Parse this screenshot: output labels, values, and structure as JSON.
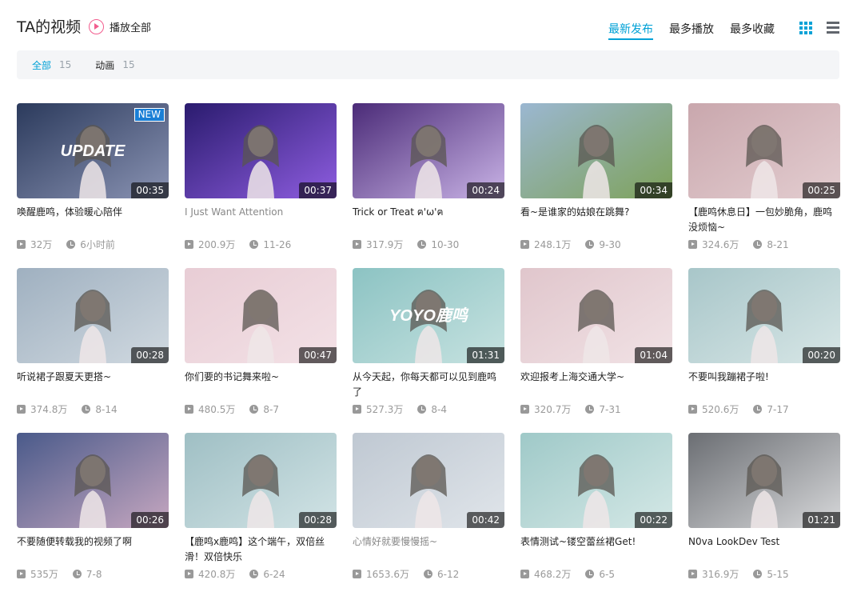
{
  "header": {
    "title": "TA的视频",
    "play_all": "播放全部",
    "sorts": [
      {
        "label": "最新发布",
        "active": true
      },
      {
        "label": "最多播放",
        "active": false
      },
      {
        "label": "最多收藏",
        "active": false
      }
    ]
  },
  "filters": [
    {
      "label": "全部",
      "count": "15",
      "active": true
    },
    {
      "label": "动画",
      "count": "15",
      "active": false
    }
  ],
  "colors": {
    "accent": "#00a1d6",
    "pink": "#f25d8e"
  },
  "videos": [
    {
      "title": "唤醒鹿鸣，体验暖心陪伴",
      "duration": "00:35",
      "views": "32万",
      "date": "6小时前",
      "badge": "NEW",
      "thumb_text": "UPDATE",
      "muted": false,
      "bg1": "#2b3a5c",
      "bg2": "#8a93b3"
    },
    {
      "title": "I Just Want Attention",
      "duration": "00:37",
      "views": "200.9万",
      "date": "11-26",
      "muted": true,
      "bg1": "#2a1b6e",
      "bg2": "#8e5de0"
    },
    {
      "title": "Trick or Treat ฅ'ω'ฅ",
      "duration": "00:24",
      "views": "317.9万",
      "date": "10-30",
      "muted": false,
      "bg1": "#4b2b78",
      "bg2": "#c9b3e6"
    },
    {
      "title": "看~是谁家的姑娘在跳舞?",
      "duration": "00:34",
      "views": "248.1万",
      "date": "9-30",
      "muted": false,
      "bg1": "#9bb7d1",
      "bg2": "#7ea25a"
    },
    {
      "title": "【鹿鸣休息日】一包妙脆角，鹿鸣没烦恼~",
      "duration": "00:25",
      "views": "324.6万",
      "date": "8-21",
      "muted": false,
      "bg1": "#c9a7ad",
      "bg2": "#e3cdd0"
    },
    {
      "title": "听说裙子跟夏天更搭~",
      "duration": "00:28",
      "views": "374.8万",
      "date": "8-14",
      "muted": false,
      "bg1": "#9fb0c0",
      "bg2": "#d0d9e0"
    },
    {
      "title": "你们要的书记舞来啦~",
      "duration": "00:47",
      "views": "480.5万",
      "date": "8-7",
      "muted": false,
      "bg1": "#e8cdd5",
      "bg2": "#f3e1e6"
    },
    {
      "title": "从今天起，你每天都可以见到鹿鸣了",
      "duration": "01:31",
      "views": "527.3万",
      "date": "8-4",
      "thumb_text": "YOYO鹿鸣",
      "muted": false,
      "bg1": "#8cc3c3",
      "bg2": "#c6e2e0"
    },
    {
      "title": "欢迎报考上海交通大学~",
      "duration": "01:04",
      "views": "320.7万",
      "date": "7-31",
      "muted": false,
      "bg1": "#e0c6cc",
      "bg2": "#f1e2e5"
    },
    {
      "title": "不要叫我蹦裙子啦!",
      "duration": "00:20",
      "views": "520.6万",
      "date": "7-17",
      "muted": false,
      "bg1": "#a8c6c9",
      "bg2": "#d7e6e6"
    },
    {
      "title": "不要随便转载我的视频了啊",
      "duration": "00:26",
      "views": "535万",
      "date": "7-8",
      "muted": false,
      "bg1": "#4a5a8a",
      "bg2": "#c6a7c0"
    },
    {
      "title": "【鹿鸣x鹿鸣】这个端午，双倍丝滑！双倍快乐",
      "duration": "00:28",
      "views": "420.8万",
      "date": "6-24",
      "muted": false,
      "bg1": "#9fbfc4",
      "bg2": "#d1e3e5"
    },
    {
      "title": "心情好就要慢慢摇~",
      "duration": "00:42",
      "views": "1653.6万",
      "date": "6-12",
      "muted": true,
      "bg1": "#bfc8d2",
      "bg2": "#e0e5ea"
    },
    {
      "title": "表情测试~镂空蕾丝裙Get!",
      "duration": "00:22",
      "views": "468.2万",
      "date": "6-5",
      "muted": false,
      "bg1": "#9fc9c8",
      "bg2": "#d4e8e6"
    },
    {
      "title": "N0va LookDev Test",
      "duration": "01:21",
      "views": "316.9万",
      "date": "5-15",
      "muted": false,
      "bg1": "#6b6e73",
      "bg2": "#d7d8da"
    }
  ]
}
